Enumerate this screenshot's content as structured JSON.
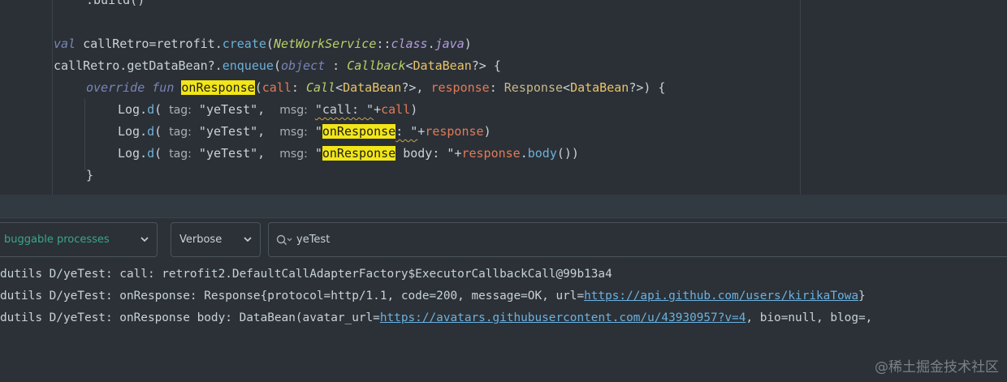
{
  "editor": {
    "build": ".build()",
    "line1": {
      "kw": "val",
      "name": "callRetro",
      "eq": "=",
      "obj": "retrofit",
      "dot": ".",
      "call": "create",
      "open": "(",
      "cls": "NetWorkService",
      "sep": "::",
      "classkw": "class",
      "dot2": ".",
      "java": "java",
      "close": ")"
    },
    "line2": {
      "obj": "callRetro",
      "dot": ".",
      "prop": "getDataBean",
      "safe": "?.",
      "call": "enqueue",
      "open": "(",
      "kw": "object",
      "colon": " : ",
      "type": "Callback",
      "lt": "<",
      "typearg": "DataBean",
      "gt": "?> {"
    },
    "line3": {
      "kw1": "override",
      "kw2": "fun",
      "fn": "onResponse",
      "open": "(",
      "p1": "call",
      "c1": ": ",
      "t1": "Call",
      "lt1": "<",
      "ta1": "DataBean",
      "gt1": "?>, ",
      "p2": "response",
      "c2": ": ",
      "t2": "Response",
      "lt2": "<",
      "ta2": "DataBean",
      "gt2": "?>) {"
    },
    "log1": {
      "obj": "Log",
      "dot": ".",
      "call": "d",
      "open": "( ",
      "hint_tag": "tag:",
      "tag": " \"yeTest\",  ",
      "hint_msg": "msg:",
      "msg_pre": " ",
      "msg": "\"call: \"",
      "plus": "+",
      "arg": "call",
      "close": ")"
    },
    "log2": {
      "obj": "Log",
      "dot": ".",
      "call": "d",
      "open": "( ",
      "hint_tag": "tag:",
      "tag": " \"yeTest\",  ",
      "hint_msg": "msg:",
      "msg_pre": " \"",
      "hl": "onResponse",
      "msg_post": ": \"",
      "plus": "+",
      "arg": "response",
      "close": ")"
    },
    "log3": {
      "obj": "Log",
      "dot": ".",
      "call": "d",
      "open": "( ",
      "hint_tag": "tag:",
      "tag": " \"yeTest\",  ",
      "hint_msg": "msg:",
      "msg_pre": " \"",
      "hl": "onResponse",
      "msg_post": " body: \"",
      "plus": "+",
      "arg": "response",
      "dot2": ".",
      "call2": "body",
      "close": "())"
    },
    "closebrace": "}"
  },
  "toolbar": {
    "process_label": "buggable processes",
    "level_label": "Verbose",
    "search_value": "yeTest"
  },
  "logcat": {
    "line1": {
      "prefix": "dutils D/yeTest: call: retrofit2.DefaultCallAdapterFactory$ExecutorCallbackCall@99b13a4"
    },
    "line2": {
      "prefix": "dutils D/yeTest: onResponse: Response{protocol=http/1.1, code=200, message=OK, url=",
      "link": "https://api.github.com/users/kirikaTowa",
      "suffix": "}"
    },
    "line3": {
      "prefix": "dutils D/yeTest: onResponse body: DataBean(avatar_url=",
      "link": "https://avatars.githubusercontent.com/u/43930957?v=4",
      "suffix": ", bio=null, blog=,"
    }
  },
  "watermark": "@稀土掘金技术社区",
  "colors": {
    "highlight": "#f2e618",
    "link": "#6bb1e0",
    "process": "#3aa58c"
  }
}
